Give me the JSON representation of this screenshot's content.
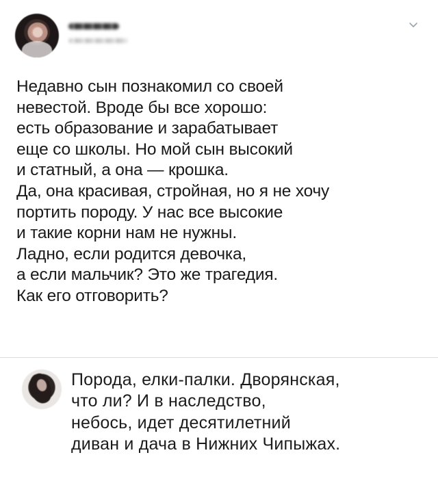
{
  "post": {
    "author": {
      "avatar_icon": "user-avatar-icon",
      "name_obscured": true,
      "handle_obscured": true
    },
    "menu_icon": "chevron-down-icon",
    "text_lines": [
      "Недавно сын познакомил со своей",
      "невестой. Вроде бы все хорошо:",
      "есть образование и зарабатывает",
      "еще со школы. Но мой сын высокий",
      "и статный, а она — крошка.",
      "Да, она красивая, стройная, но я не хочу",
      "портить породу. У нас все высокие",
      "и такие корни нам не нужны.",
      "Ладно, если родится девочка,",
      "а если мальчик? Это же трагедия.",
      "Как его отговорить?"
    ]
  },
  "reply": {
    "avatar_icon": "user-avatar-icon",
    "text_lines": [
      "Порода, елки-палки. Дворянская,",
      "что ли? И в наследство,",
      "небось, идет десятилетний",
      "диван и дача в Нижних Чипыжах."
    ]
  },
  "colors": {
    "text": "#1a1a1a",
    "divider": "#dcdcdc",
    "chevron": "#9aa4ad",
    "background": "#ffffff"
  }
}
